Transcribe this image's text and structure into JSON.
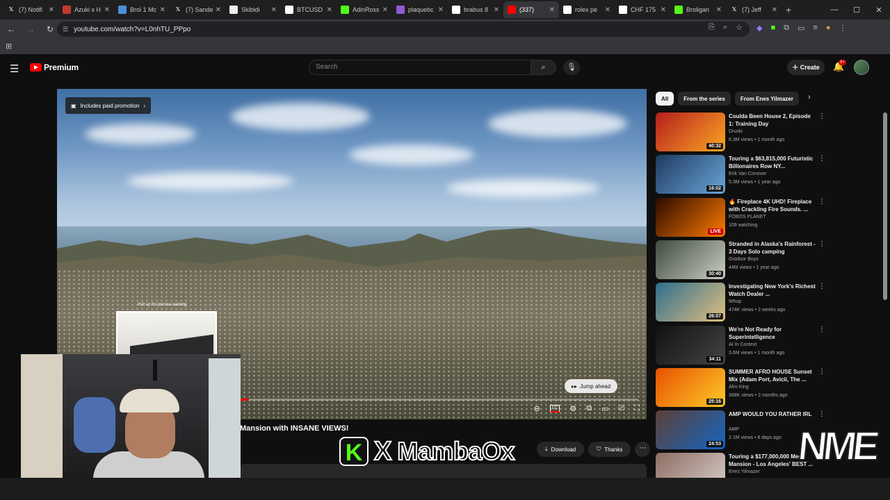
{
  "browser": {
    "tabs": [
      {
        "label": "(7) Notifi",
        "icon": "x-icon",
        "color": "#ffffff"
      },
      {
        "label": "Azuki x H",
        "icon": "azuki-icon",
        "color": "#c0392b"
      },
      {
        "label": "Brol 1 Mc",
        "icon": "globe-icon",
        "color": "#4a90d9"
      },
      {
        "label": "(7) Sande",
        "icon": "x-icon",
        "color": "#ffffff"
      },
      {
        "label": "Skibidi",
        "icon": "page-icon",
        "color": "#eeeeee"
      },
      {
        "label": "BTCUSD",
        "icon": "tradingview-icon",
        "color": "#ffffff"
      },
      {
        "label": "AdinRoss",
        "icon": "kick-icon",
        "color": "#53fc18"
      },
      {
        "label": "plaquebc",
        "icon": "app-icon",
        "color": "#8e5bd6"
      },
      {
        "label": "brabus 8",
        "icon": "google-icon",
        "color": "#ffffff"
      },
      {
        "label": "(337)",
        "icon": "youtube-icon",
        "color": "#ff0000"
      },
      {
        "label": "rolex pe",
        "icon": "google-icon",
        "color": "#ffffff"
      },
      {
        "label": "CHF 175",
        "icon": "google-icon",
        "color": "#ffffff"
      },
      {
        "label": "Broligan",
        "icon": "kick-icon",
        "color": "#53fc18"
      },
      {
        "label": "(7) Jeff",
        "icon": "x-icon",
        "color": "#ffffff"
      }
    ],
    "url": "youtube.com/watch?v=L0nhTU_PPpo"
  },
  "youtube": {
    "brand": "Premium",
    "search_placeholder": "Search",
    "create_label": "Create",
    "notif_count": "9+",
    "promo_label": "Includes paid promotion",
    "seek_hint": "Pull up for precise seeking",
    "jump_ahead": "Jump ahead",
    "video_title": "Mansion with INSANE VIEWS!",
    "download_label": "Download",
    "thanks_label": "Thanks",
    "progress": 0.32,
    "chips": [
      "All",
      "From the series",
      "From Enes Yilmazer"
    ],
    "recs": [
      {
        "title": "Coulda Been House 2, Episode 1: Training Day",
        "channel": "Druski",
        "meta": "6.3M views • 1 month ago",
        "duration": "40:32",
        "c1": "#b71c1c",
        "c2": "#f9a825"
      },
      {
        "title": "Touring a $63,815,000 Futuristic Billionaires Row NY...",
        "channel": "Erik Van Conover",
        "meta": "5.3M views • 1 year ago",
        "duration": "16:02",
        "c1": "#1e3a5f",
        "c2": "#6aa5d8"
      },
      {
        "title": "🔥 Fireplace 4K UHD! Fireplace with Crackling Fire Sounds. ...",
        "channel": "FOBOS PLANET",
        "meta": "109 watching",
        "duration": "LIVE",
        "c1": "#2b0a00",
        "c2": "#ff7a00"
      },
      {
        "title": "Stranded in Alaska's Rainforest - 3 Days Solo camping",
        "channel": "Outdoor Boys",
        "meta": "44M views • 1 year ago",
        "duration": "30:40",
        "c1": "#3f4a3c",
        "c2": "#c9cfc4"
      },
      {
        "title": "Investigating New York's Richest Watch Dealer ...",
        "channel": "Whop",
        "meta": "474K views • 2 weeks ago",
        "duration": "26:07",
        "c1": "#2e6e8e",
        "c2": "#e0c080"
      },
      {
        "title": "We're Not Ready for Superintelligence",
        "channel": "AI In Context",
        "meta": "3.6M views • 1 month ago",
        "duration": "34:11",
        "c1": "#111111",
        "c2": "#444444"
      },
      {
        "title": "SUMMER AFRO HOUSE Sunset Mix (Adam Port, Avicii, The ...",
        "channel": "Afro King",
        "meta": "398K views • 2 months ago",
        "duration": "25:16",
        "c1": "#e65100",
        "c2": "#ffca28"
      },
      {
        "title": "AMP WOULD YOU RATHER IRL",
        "channel": "AMP",
        "meta": "2.1M views • 8 days ago",
        "duration": "24:53",
        "c1": "#5d4037",
        "c2": "#1565c0"
      },
      {
        "title": "Touring a $177,000,000 Mega Mansion - Los Angeles' BEST ...",
        "channel": "Enes Yilmazer",
        "meta": "",
        "duration": "",
        "c1": "#8d6e63",
        "c2": "#d7ccc8"
      }
    ]
  },
  "overlay": {
    "mamba_k": "K",
    "mamba_x": "X",
    "mamba_name": "MambaOx",
    "nme": "NME"
  }
}
